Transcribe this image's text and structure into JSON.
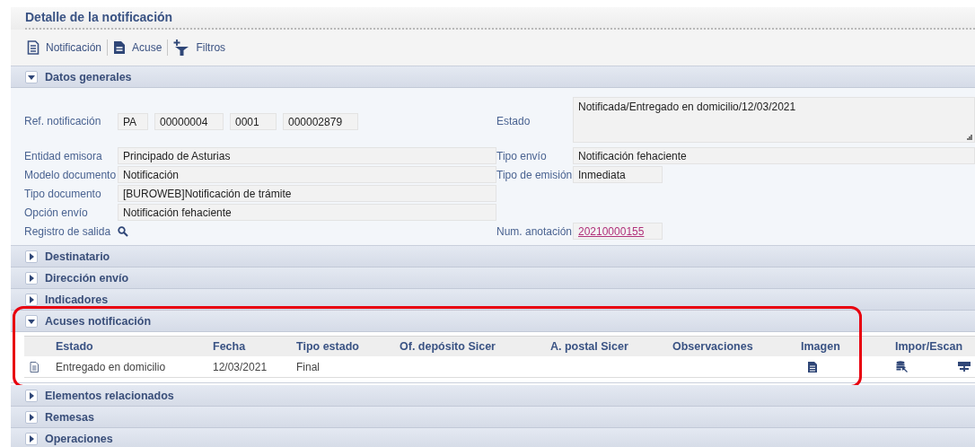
{
  "window": {
    "title": "Detalle de la notificación"
  },
  "toolbar": [
    {
      "label": "Notificación"
    },
    {
      "label": "Acuse"
    },
    {
      "label": "Filtros"
    }
  ],
  "sections": [
    {
      "title": "Datos generales",
      "expanded": true,
      "highlighted": false,
      "kind": "form",
      "form": {
        "rows": [
          {
            "left": {
              "label": "Ref. notificación",
              "kind": "segments",
              "values": [
                "PA",
                "00000004",
                "0001",
                "000002879"
              ]
            },
            "right": {
              "label": "Estado",
              "kind": "textarea",
              "value": "Notificada/Entregado en domicilio/12/03/2021"
            }
          },
          {
            "left": {
              "label": "Entidad emisora",
              "kind": "wide",
              "value": "Principado de Asturias"
            },
            "right": {
              "label": "Tipo envío",
              "kind": "wide",
              "value": "Notificación fehaciente"
            }
          },
          {
            "left": {
              "label": "Modelo documento",
              "kind": "wide",
              "value": "Notificación"
            },
            "right": {
              "label": "Tipo de emisión",
              "kind": "short",
              "value": "Inmediata"
            }
          },
          {
            "left": {
              "label": "Tipo documento",
              "kind": "wide",
              "value": "[BUROWEB]Notificación de trámite"
            }
          },
          {
            "left": {
              "label": "Opción envío",
              "kind": "wide",
              "value": "Notificación fehaciente"
            }
          },
          {
            "left": {
              "label": "Registro de salida",
              "kind": "search"
            },
            "right": {
              "label": "Num. anotación",
              "kind": "link",
              "value": "20210000155"
            }
          }
        ]
      }
    },
    {
      "title": "Destinatario",
      "expanded": false,
      "highlighted": false,
      "kind": "none"
    },
    {
      "title": "Dirección envío",
      "expanded": false,
      "highlighted": false,
      "kind": "none"
    },
    {
      "title": "Indicadores",
      "expanded": false,
      "highlighted": false,
      "kind": "none"
    },
    {
      "title": "Acuses notificación",
      "expanded": true,
      "highlighted": true,
      "kind": "table",
      "table": {
        "columns": [
          "Estado",
          "Fecha",
          "Tipo estado",
          "Of. depósito Sicer",
          "A. postal Sicer",
          "Observaciones",
          "Imagen",
          "Impor/Escan"
        ],
        "rows": [
          {
            "cells": [
              "Entregado en domicilio",
              "12/03/2021",
              "Final"
            ]
          }
        ]
      }
    },
    {
      "title": "Elementos relacionados",
      "expanded": false,
      "highlighted": false,
      "kind": "none"
    },
    {
      "title": "Remesas",
      "expanded": false,
      "highlighted": false,
      "kind": "none"
    },
    {
      "title": "Operaciones",
      "expanded": false,
      "highlighted": false,
      "kind": "none"
    }
  ]
}
